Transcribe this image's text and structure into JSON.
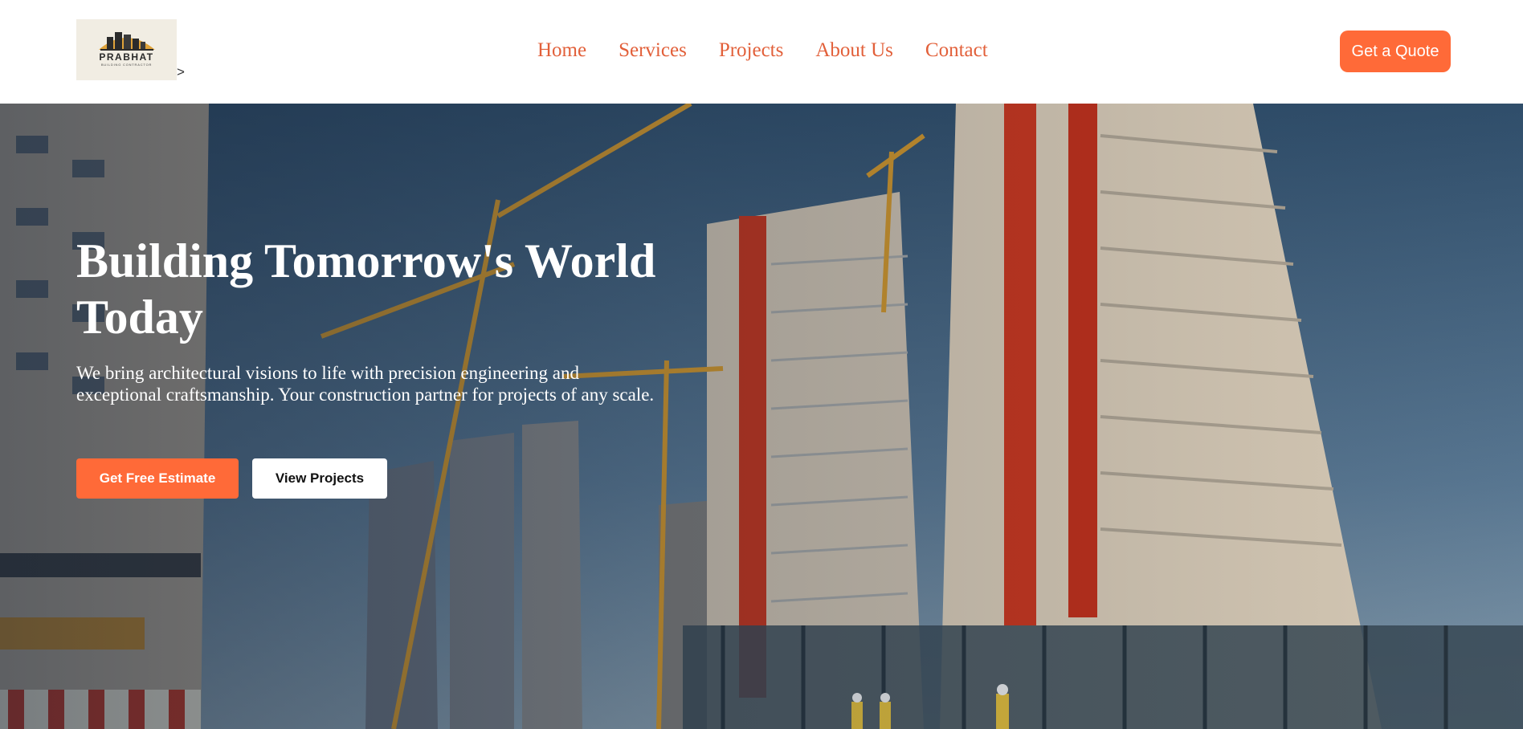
{
  "brand": {
    "logo_text": "PRABHAT",
    "logo_subtext": "BUILDING CONTRACTOR",
    "stray_glyph": ">"
  },
  "nav": {
    "items": [
      {
        "label": "Home"
      },
      {
        "label": "Services"
      },
      {
        "label": "Projects"
      },
      {
        "label": "About Us"
      },
      {
        "label": "Contact"
      }
    ]
  },
  "header": {
    "quote_button": "Get a Quote"
  },
  "hero": {
    "title": "Building Tomorrow's World Today",
    "subtitle": "We bring architectural visions to life with precision engineering and exceptional craftsmanship. Your construction partner for projects of any scale.",
    "primary_button": "Get Free Estimate",
    "secondary_button": "View Projects",
    "background_image": "construction-site-photo"
  },
  "colors": {
    "accent": "#ff6a38",
    "nav_link": "#e2603a",
    "hero_text": "#ffffff"
  }
}
